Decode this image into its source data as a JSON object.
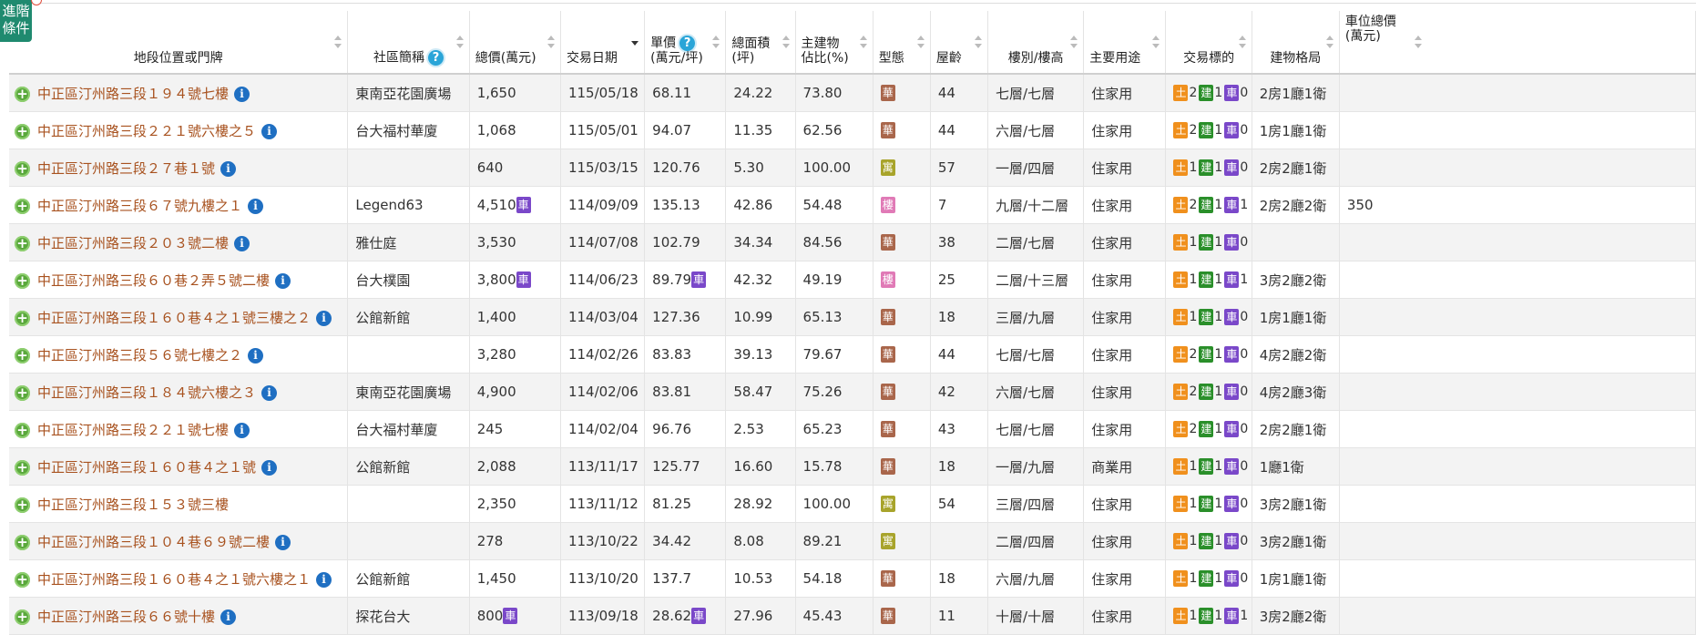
{
  "adv_button": {
    "line1": "進階",
    "line2": "條件"
  },
  "headers": {
    "addr": "地段位置或門牌",
    "community": "社區簡稱",
    "total_price": "總價(萬元)",
    "date": "交易日期",
    "unit_price_l1": "單價",
    "unit_price_l2": "(萬元/坪)",
    "area_l1": "總面積",
    "area_l2": "(坪)",
    "main_l1": "主建物",
    "main_l2": "佔比(%)",
    "type": "型態",
    "age": "屋齡",
    "floor": "樓別/樓高",
    "usage": "主要用途",
    "target": "交易標的",
    "layout": "建物格局",
    "parking_l1": "車位總價",
    "parking_l2": "(萬元)"
  },
  "help_icon": "?",
  "info_icon": "i",
  "plus_icon": "+",
  "tag_labels": {
    "hua": "華",
    "yu": "寓",
    "lou": "樓",
    "tu": "土",
    "jian": "建",
    "che": "車"
  },
  "colors": {
    "address": "#a8521f",
    "plus": "#5aa83c",
    "info": "#1f6fc2",
    "help": "#2aa5d8",
    "adv_button": "#1f8a6f"
  },
  "rows": [
    {
      "addr": "中正區汀州路三段１９４號七樓",
      "community": "東南亞花園廣場",
      "total": "1,650",
      "total_car": false,
      "date": "115/05/18",
      "unit": "68.11",
      "unit_car": false,
      "area": "24.22",
      "main": "73.80",
      "type": "hua",
      "age": "44",
      "floor": "七層/七層",
      "usage": "住家用",
      "tu": "2",
      "jian": "1",
      "che": "0",
      "layout": "2房1廳1衛",
      "parking": ""
    },
    {
      "addr": "中正區汀州路三段２２１號六樓之５",
      "community": "台大福村華廈",
      "total": "1,068",
      "total_car": false,
      "date": "115/05/01",
      "unit": "94.07",
      "unit_car": false,
      "area": "11.35",
      "main": "62.56",
      "type": "hua",
      "age": "44",
      "floor": "六層/七層",
      "usage": "住家用",
      "tu": "2",
      "jian": "1",
      "che": "0",
      "layout": "1房1廳1衛",
      "parking": ""
    },
    {
      "addr": "中正區汀州路三段２７巷１號",
      "community": "",
      "total": "640",
      "total_car": false,
      "date": "115/03/15",
      "unit": "120.76",
      "unit_car": false,
      "area": "5.30",
      "main": "100.00",
      "type": "yu",
      "age": "57",
      "floor": "一層/四層",
      "usage": "住家用",
      "tu": "1",
      "jian": "1",
      "che": "0",
      "layout": "2房2廳1衛",
      "parking": ""
    },
    {
      "addr": "中正區汀州路三段６７號九樓之１",
      "community": "Legend63",
      "total": "4,510",
      "total_car": true,
      "date": "114/09/09",
      "unit": "135.13",
      "unit_car": false,
      "area": "42.86",
      "main": "54.48",
      "type": "lou",
      "age": "7",
      "floor": "九層/十二層",
      "usage": "住家用",
      "tu": "2",
      "jian": "1",
      "che": "1",
      "layout": "2房2廳2衛",
      "parking": "350"
    },
    {
      "addr": "中正區汀州路三段２０３號二樓",
      "community": "雅仕庭",
      "total": "3,530",
      "total_car": false,
      "date": "114/07/08",
      "unit": "102.79",
      "unit_car": false,
      "area": "34.34",
      "main": "84.56",
      "type": "hua",
      "age": "38",
      "floor": "二層/七層",
      "usage": "住家用",
      "tu": "1",
      "jian": "1",
      "che": "0",
      "layout": "",
      "parking": ""
    },
    {
      "addr": "中正區汀州路三段６０巷２弄５號二樓",
      "community": "台大樸園",
      "total": "3,800",
      "total_car": true,
      "date": "114/06/23",
      "unit": "89.79",
      "unit_car": true,
      "area": "42.32",
      "main": "49.19",
      "type": "lou",
      "age": "25",
      "floor": "二層/十三層",
      "usage": "住家用",
      "tu": "1",
      "jian": "1",
      "che": "1",
      "layout": "3房2廳2衛",
      "parking": ""
    },
    {
      "addr": "中正區汀州路三段１６０巷４之１號三樓之２",
      "community": "公館新館",
      "total": "1,400",
      "total_car": false,
      "date": "114/03/04",
      "unit": "127.36",
      "unit_car": false,
      "area": "10.99",
      "main": "65.13",
      "type": "hua",
      "age": "18",
      "floor": "三層/九層",
      "usage": "住家用",
      "tu": "1",
      "jian": "1",
      "che": "0",
      "layout": "1房1廳1衛",
      "parking": ""
    },
    {
      "addr": "中正區汀州路三段５６號七樓之２",
      "community": "",
      "total": "3,280",
      "total_car": false,
      "date": "114/02/26",
      "unit": "83.83",
      "unit_car": false,
      "area": "39.13",
      "main": "79.67",
      "type": "hua",
      "age": "44",
      "floor": "七層/七層",
      "usage": "住家用",
      "tu": "2",
      "jian": "1",
      "che": "0",
      "layout": "4房2廳2衛",
      "parking": ""
    },
    {
      "addr": "中正區汀州路三段１８４號六樓之３",
      "community": "東南亞花園廣場",
      "total": "4,900",
      "total_car": false,
      "date": "114/02/06",
      "unit": "83.81",
      "unit_car": false,
      "area": "58.47",
      "main": "75.26",
      "type": "hua",
      "age": "42",
      "floor": "六層/七層",
      "usage": "住家用",
      "tu": "2",
      "jian": "1",
      "che": "0",
      "layout": "4房2廳3衛",
      "parking": ""
    },
    {
      "addr": "中正區汀州路三段２２１號七樓",
      "community": "台大福村華廈",
      "total": "245",
      "total_car": false,
      "date": "114/02/04",
      "unit": "96.76",
      "unit_car": false,
      "area": "2.53",
      "main": "65.23",
      "type": "hua",
      "age": "43",
      "floor": "七層/七層",
      "usage": "住家用",
      "tu": "2",
      "jian": "1",
      "che": "0",
      "layout": "2房2廳1衛",
      "parking": ""
    },
    {
      "addr": "中正區汀州路三段１６０巷４之１號",
      "community": "公館新館",
      "total": "2,088",
      "total_car": false,
      "date": "113/11/17",
      "unit": "125.77",
      "unit_car": false,
      "area": "16.60",
      "main": "15.78",
      "type": "hua",
      "age": "18",
      "floor": "一層/九層",
      "usage": "商業用",
      "tu": "1",
      "jian": "1",
      "che": "0",
      "layout": "1廳1衛",
      "parking": ""
    },
    {
      "addr": "中正區汀州路三段１５３號三樓",
      "community": "",
      "total": "2,350",
      "total_car": false,
      "date": "113/11/12",
      "unit": "81.25",
      "unit_car": false,
      "area": "28.92",
      "main": "100.00",
      "type": "yu",
      "age": "54",
      "floor": "三層/四層",
      "usage": "住家用",
      "tu": "1",
      "jian": "1",
      "che": "0",
      "layout": "3房2廳1衛",
      "parking": "",
      "no_info": true
    },
    {
      "addr": "中正區汀州路三段１０４巷６９號二樓",
      "community": "",
      "total": "278",
      "total_car": false,
      "date": "113/10/22",
      "unit": "34.42",
      "unit_car": false,
      "area": "8.08",
      "main": "89.21",
      "type": "yu",
      "age": "",
      "floor": "二層/四層",
      "usage": "住家用",
      "tu": "1",
      "jian": "1",
      "che": "0",
      "layout": "3房2廳1衛",
      "parking": ""
    },
    {
      "addr": "中正區汀州路三段１６０巷４之１號六樓之１",
      "community": "公館新館",
      "total": "1,450",
      "total_car": false,
      "date": "113/10/20",
      "unit": "137.7",
      "unit_car": false,
      "area": "10.53",
      "main": "54.18",
      "type": "hua",
      "age": "18",
      "floor": "六層/九層",
      "usage": "住家用",
      "tu": "1",
      "jian": "1",
      "che": "0",
      "layout": "1房1廳1衛",
      "parking": ""
    },
    {
      "addr": "中正區汀州路三段６６號十樓",
      "community": "探花台大",
      "total": "800",
      "total_car": true,
      "date": "113/09/18",
      "unit": "28.62",
      "unit_car": true,
      "area": "27.96",
      "main": "45.43",
      "type": "hua",
      "age": "11",
      "floor": "十層/十層",
      "usage": "住家用",
      "tu": "1",
      "jian": "1",
      "che": "1",
      "layout": "3房2廳2衛",
      "parking": ""
    }
  ]
}
